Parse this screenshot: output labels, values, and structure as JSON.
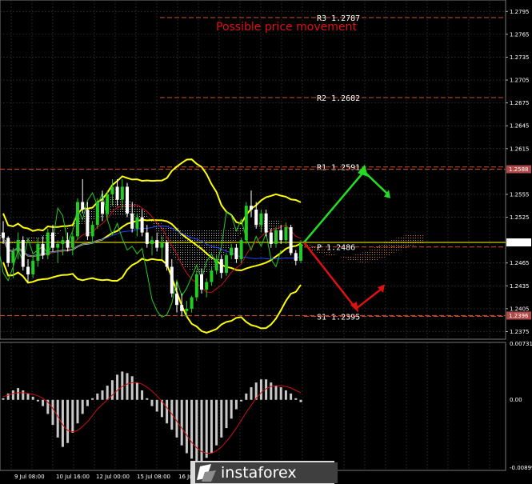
{
  "chart_data": [
    {
      "type": "candlestick",
      "title": "Possible price movement",
      "ylim": [
        1.2365,
        1.281
      ],
      "y_ticks": [
        "1.2795",
        "1.2765",
        "1.2735",
        "1.2705",
        "1.2675",
        "1.2645",
        "1.2615",
        "1.2555",
        "1.2525",
        "1.2465",
        "1.2435",
        "1.2405",
        "1.2375"
      ],
      "price_labels": [
        {
          "text": "1.2588",
          "value": 1.2588
        },
        {
          "text": "1.2492",
          "value": 1.2492
        },
        {
          "text": "1.2396",
          "value": 1.2396
        }
      ],
      "levels": [
        {
          "name": "R3",
          "text": "R3 1.2787",
          "value": 1.2787
        },
        {
          "name": "R2",
          "text": "R2 1.2682",
          "value": 1.2682
        },
        {
          "name": "R1",
          "text": "R1 1.2591",
          "value": 1.2591
        },
        {
          "name": "P",
          "text": "P 1.2486",
          "value": 1.2486
        },
        {
          "name": "S1",
          "text": "S1 1.2395",
          "value": 1.2395
        }
      ],
      "x_labels": [
        "9 Jul 08:00",
        "10 Jul 16:00",
        "12 Jul 00:00",
        "15 Jul 08:00",
        "16 Jul"
      ],
      "candles": [
        [
          1.2505,
          1.252,
          1.249,
          1.2498
        ],
        [
          1.2498,
          1.25,
          1.246,
          1.2465
        ],
        [
          1.2465,
          1.2485,
          1.2445,
          1.248
        ],
        [
          1.248,
          1.2505,
          1.247,
          1.2495
        ],
        [
          1.2495,
          1.25,
          1.2455,
          1.246
        ],
        [
          1.246,
          1.247,
          1.244,
          1.245
        ],
        [
          1.245,
          1.2475,
          1.2445,
          1.2468
        ],
        [
          1.2468,
          1.2498,
          1.246,
          1.249
        ],
        [
          1.249,
          1.25,
          1.247,
          1.2475
        ],
        [
          1.2475,
          1.251,
          1.247,
          1.2505
        ],
        [
          1.2505,
          1.2515,
          1.248,
          1.2485
        ],
        [
          1.2485,
          1.2495,
          1.2465,
          1.249
        ],
        [
          1.249,
          1.25,
          1.2475,
          1.2495
        ],
        [
          1.2495,
          1.2505,
          1.248,
          1.2485
        ],
        [
          1.2485,
          1.2505,
          1.2475,
          1.25
        ],
        [
          1.25,
          1.255,
          1.2495,
          1.2545
        ],
        [
          1.2545,
          1.2575,
          1.253,
          1.2535
        ],
        [
          1.2535,
          1.2545,
          1.2495,
          1.25
        ],
        [
          1.25,
          1.252,
          1.249,
          1.2515
        ],
        [
          1.2515,
          1.255,
          1.251,
          1.2545
        ],
        [
          1.2545,
          1.256,
          1.252,
          1.253
        ],
        [
          1.253,
          1.256,
          1.2525,
          1.2555
        ],
        [
          1.2555,
          1.2575,
          1.254,
          1.2565
        ],
        [
          1.2565,
          1.2575,
          1.254,
          1.2548
        ],
        [
          1.2548,
          1.2575,
          1.2535,
          1.2565
        ],
        [
          1.2565,
          1.257,
          1.2525,
          1.253
        ],
        [
          1.253,
          1.2545,
          1.2505,
          1.251
        ],
        [
          1.251,
          1.253,
          1.25,
          1.2525
        ],
        [
          1.2525,
          1.2535,
          1.25,
          1.2505
        ],
        [
          1.2505,
          1.2515,
          1.2485,
          1.249
        ],
        [
          1.249,
          1.25,
          1.2475,
          1.2495
        ],
        [
          1.2495,
          1.2505,
          1.248,
          1.2485
        ],
        [
          1.2485,
          1.25,
          1.247,
          1.2492
        ],
        [
          1.2492,
          1.2495,
          1.2455,
          1.246
        ],
        [
          1.246,
          1.247,
          1.242,
          1.2425
        ],
        [
          1.2425,
          1.244,
          1.24,
          1.241
        ],
        [
          1.241,
          1.2425,
          1.2395,
          1.2402
        ],
        [
          1.2402,
          1.2415,
          1.2395,
          1.2405
        ],
        [
          1.2405,
          1.2422,
          1.24,
          1.242
        ],
        [
          1.242,
          1.2455,
          1.2415,
          1.245
        ],
        [
          1.245,
          1.2458,
          1.2425,
          1.243
        ],
        [
          1.243,
          1.2445,
          1.242,
          1.244
        ],
        [
          1.244,
          1.246,
          1.2435,
          1.2455
        ],
        [
          1.2455,
          1.2475,
          1.245,
          1.247
        ],
        [
          1.247,
          1.2475,
          1.2445,
          1.2452
        ],
        [
          1.2452,
          1.2478,
          1.2448,
          1.2475
        ],
        [
          1.2475,
          1.249,
          1.247,
          1.2485
        ],
        [
          1.2485,
          1.249,
          1.2465,
          1.247
        ],
        [
          1.247,
          1.2498,
          1.2465,
          1.2495
        ],
        [
          1.2495,
          1.2545,
          1.249,
          1.254
        ],
        [
          1.254,
          1.256,
          1.2525,
          1.2535
        ],
        [
          1.2535,
          1.2545,
          1.251,
          1.2515
        ],
        [
          1.2515,
          1.2535,
          1.2505,
          1.253
        ],
        [
          1.253,
          1.2535,
          1.25,
          1.2505
        ],
        [
          1.2505,
          1.251,
          1.2485,
          1.249
        ],
        [
          1.249,
          1.2512,
          1.2485,
          1.2508
        ],
        [
          1.2508,
          1.2515,
          1.249,
          1.2495
        ],
        [
          1.2495,
          1.2518,
          1.249,
          1.2512
        ],
        [
          1.2512,
          1.2515,
          1.2475,
          1.2478
        ],
        [
          1.2478,
          1.2482,
          1.2462,
          1.2468
        ],
        [
          1.2468,
          1.2495,
          1.2465,
          1.249
        ]
      ],
      "macd_ylim": [
        -0.00899,
        0.00731
      ],
      "macd_ticks": [
        "0.00731",
        "0.00",
        "-0.00899"
      ],
      "macd_hist": [
        0.0002,
        0.0008,
        0.0012,
        0.0015,
        0.0012,
        0.0008,
        0.0004,
        -0.0002,
        -0.0008,
        -0.0018,
        -0.0032,
        -0.0048,
        -0.006,
        -0.0055,
        -0.0042,
        -0.003,
        -0.0018,
        -0.0008,
        0.0002,
        0.0008,
        0.0012,
        0.0018,
        0.0025,
        0.0032,
        0.0036,
        0.0034,
        0.003,
        0.0022,
        0.0012,
        0.0002,
        -0.0008,
        -0.0015,
        -0.0022,
        -0.003,
        -0.0038,
        -0.0048,
        -0.0058,
        -0.0068,
        -0.0075,
        -0.008,
        -0.0078,
        -0.0074,
        -0.0068,
        -0.0058,
        -0.0048,
        -0.0036,
        -0.0024,
        -0.0012,
        -0.0002,
        0.0008,
        0.0016,
        0.0022,
        0.0026,
        0.0026,
        0.0022,
        0.0018,
        0.0016,
        0.0012,
        0.0008,
        0.0002,
        -0.0003
      ],
      "macd_signal": [
        0.0004,
        0.0006,
        0.0008,
        0.0009,
        0.0009,
        0.0008,
        0.0007,
        0.0005,
        0.0002,
        -0.0003,
        -0.0011,
        -0.0021,
        -0.0032,
        -0.0039,
        -0.0041,
        -0.0039,
        -0.0034,
        -0.0028,
        -0.002,
        -0.0012,
        -0.0006,
        0.0,
        0.0006,
        0.0012,
        0.0017,
        0.002,
        0.0022,
        0.0022,
        0.002,
        0.0016,
        0.0011,
        0.0005,
        -0.0002,
        -0.001,
        -0.0018,
        -0.0027,
        -0.0036,
        -0.0045,
        -0.0054,
        -0.0061,
        -0.0066,
        -0.0068,
        -0.0068,
        -0.0065,
        -0.006,
        -0.0053,
        -0.0045,
        -0.0036,
        -0.0026,
        -0.0016,
        -0.0007,
        0.0002,
        0.0009,
        0.0014,
        0.0017,
        0.0018,
        0.0018,
        0.0017,
        0.0015,
        0.0012,
        0.0009
      ],
      "series": [
        {
          "name": "bollinger-upper",
          "color": "#ffff00"
        },
        {
          "name": "bollinger-middle",
          "color": "#ffff00"
        },
        {
          "name": "bollinger-lower",
          "color": "#ffff00"
        },
        {
          "name": "moving-average-red",
          "color": "#cc1111"
        },
        {
          "name": "moving-average-blue",
          "color": "#2244ff"
        },
        {
          "name": "chikou-green",
          "color": "#22cc22"
        },
        {
          "name": "ichimoku-cloud",
          "color": "#ffffff"
        },
        {
          "name": "projected-cloud",
          "color": "#ff9a3c"
        }
      ],
      "colors": {
        "bull": "#22cc22",
        "bear": "#ffffff",
        "grid": "#3a3a3a",
        "level_line": "#b44a2a"
      }
    }
  ],
  "watermark": {
    "text": "instaforex"
  }
}
